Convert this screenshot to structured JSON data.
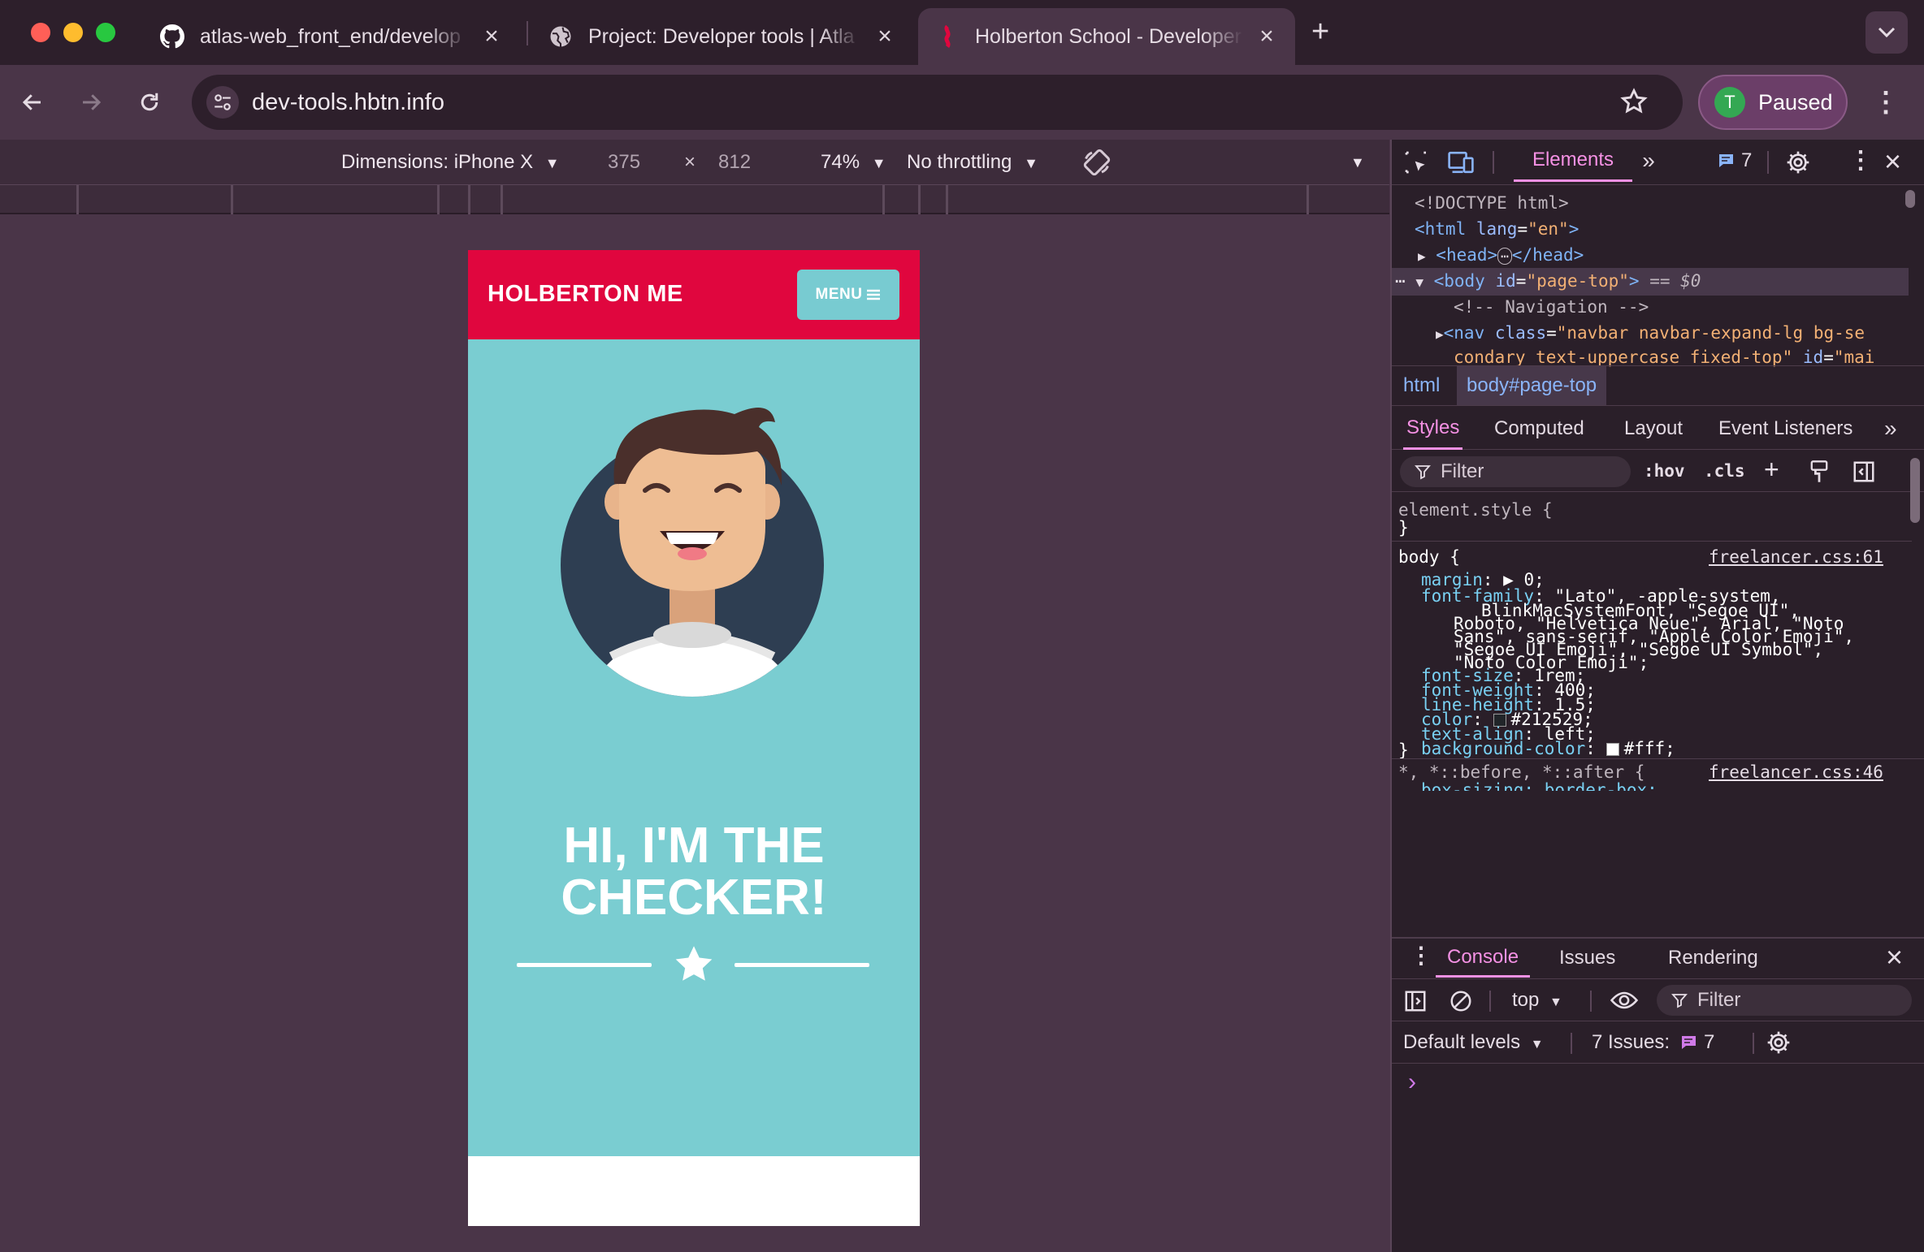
{
  "browser": {
    "tabs": [
      {
        "title": "atlas-web_front_end/develop",
        "icon": "github-icon"
      },
      {
        "title": "Project: Developer tools | Atla",
        "icon": "globe-icon"
      },
      {
        "title": "Holberton School - Developer",
        "icon": "holberton-icon",
        "active": true
      }
    ],
    "new_tab_label": "+",
    "url": "dev-tools.hbtn.info",
    "profile": {
      "initial": "T",
      "label": "Paused"
    }
  },
  "device_toolbar": {
    "dimensions_label": "Dimensions: iPhone X",
    "width": "375",
    "times": "×",
    "height": "812",
    "zoom": "74%",
    "throttling": "No throttling"
  },
  "page": {
    "brand": "HOLBERTON ME",
    "menu_label": "MENU",
    "heading_line1": "HI, I'M THE",
    "heading_line2": "CHECKER!"
  },
  "devtools": {
    "top_tabs": {
      "elements": "Elements",
      "more": "»",
      "issues_count": "7"
    },
    "dom": {
      "doctype": "<!DOCTYPE html>",
      "html_open": "<html",
      "html_attr": "lang",
      "html_val": "\"en\"",
      "html_close": ">",
      "head": "<head>",
      "head_ellipsis": "⋯",
      "head_close": "</head>",
      "body_open": "<body",
      "body_attr": "id",
      "body_val": "\"page-top\"",
      "body_close": ">",
      "body_suffix": "== $0",
      "comment": "<!-- Navigation -->",
      "nav_open": "<nav",
      "nav_attr": "class",
      "nav_val1": "\"navbar navbar-expand-lg bg-se",
      "nav_val2": "condary text-uppercase fixed-top\"",
      "nav_attr2": "id",
      "nav_val3": "\"mai"
    },
    "breadcrumb": {
      "html": "html",
      "body": "body#page-top"
    },
    "styles_tabs": {
      "styles": "Styles",
      "computed": "Computed",
      "layout": "Layout",
      "listeners": "Event Listeners",
      "more": "»"
    },
    "filter": {
      "placeholder": "Filter",
      "hov": ":hov",
      "cls": ".cls"
    },
    "rules": {
      "element_style": "element.style {",
      "close": "}",
      "body_selector": "body {",
      "body_source": "freelancer.css:61",
      "decls": [
        {
          "prop": "margin",
          "val": "▶ 0;"
        },
        {
          "prop": "font-family",
          "val": "\"Lato\", -apple-system,"
        },
        {
          "prop": "",
          "val": "BlinkMacSystemFont, \"Segoe UI\","
        },
        {
          "prop": "",
          "val": "Roboto, \"Helvetica Neue\", Arial, \"Noto"
        },
        {
          "prop": "",
          "val": "Sans\", sans-serif, \"Apple Color Emoji\","
        },
        {
          "prop": "",
          "val": "\"Segoe UI Emoji\", \"Segoe UI Symbol\","
        },
        {
          "prop": "",
          "val": "\"Noto Color Emoji\";"
        },
        {
          "prop": "font-size",
          "val": "1rem;"
        },
        {
          "prop": "font-weight",
          "val": "400;"
        },
        {
          "prop": "line-height",
          "val": "1.5;"
        },
        {
          "prop": "color",
          "val": "#212529;"
        },
        {
          "prop": "text-align",
          "val": "left;"
        },
        {
          "prop": "background-color",
          "val": "#fff;"
        }
      ],
      "star_selector": "*, *::before, *::after {",
      "star_source": "freelancer.css:46",
      "star_decl": "box-sizing: border-box;"
    },
    "drawer": {
      "console": "Console",
      "issues": "Issues",
      "rendering": "Rendering",
      "context": "top",
      "filter": "Filter",
      "levels": "Default levels",
      "issues_label": "7 Issues:",
      "issues_count": "7",
      "prompt": "›"
    }
  },
  "colors": {
    "brand_red": "#e0063e",
    "hero_teal": "#7acdd1",
    "devtools_accent": "#f591e4"
  }
}
